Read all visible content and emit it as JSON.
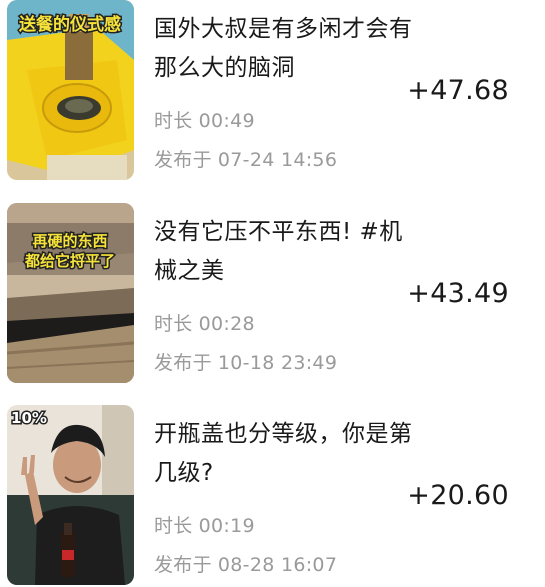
{
  "videos": [
    {
      "title": "国外大叔是有多闲才会有那么大的脑洞",
      "thumb_caption": "送餐的仪式感",
      "duration_label": "时长",
      "duration": "00:49",
      "published_label": "发布于",
      "published": "07-24 14:56",
      "amount": "+47.68"
    },
    {
      "title": "没有它压不平东西! #机械之美",
      "thumb_caption_line1": "再硬的东西",
      "thumb_caption_line2": "都给它捋平了",
      "duration_label": "时长",
      "duration": "00:28",
      "published_label": "发布于",
      "published": "10-18 23:49",
      "amount": "+43.49"
    },
    {
      "title": "开瓶盖也分等级，你是第几级?",
      "thumb_caption": "10%",
      "duration_label": "时长",
      "duration": "00:19",
      "published_label": "发布于",
      "published": "08-28 16:07",
      "amount": "+20.60"
    }
  ],
  "colors": {
    "title": "#1a1a1a",
    "meta": "#9a9a9a",
    "amount": "#1a1a1a"
  }
}
